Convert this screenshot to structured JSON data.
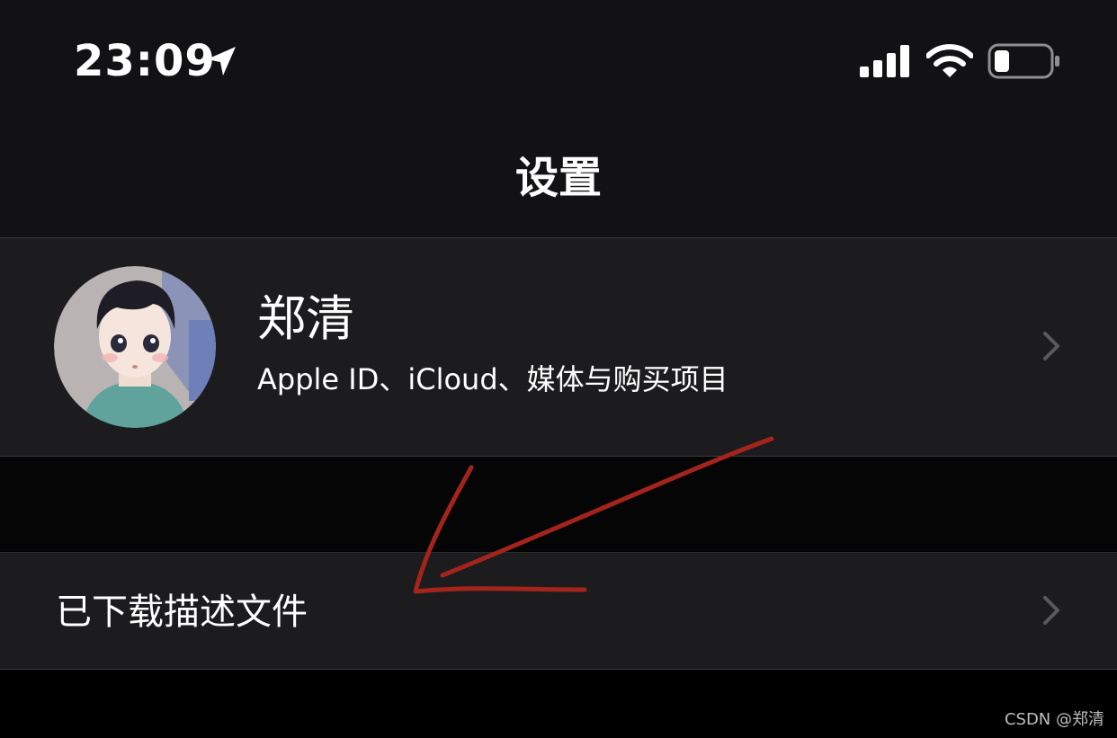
{
  "status_bar": {
    "time": "23:09",
    "icons": [
      "location-icon",
      "signal-icon",
      "wifi-icon",
      "battery-icon"
    ]
  },
  "nav": {
    "title": "设置"
  },
  "apple_id": {
    "name": "郑清",
    "subtitle": "Apple ID、iCloud、媒体与购买项目"
  },
  "profiles": {
    "label": "已下载描述文件"
  },
  "watermark": "CSDN @郑清",
  "colors": {
    "background": "#000000",
    "cell": "#1c1c1e",
    "separator": "#3a3a3c",
    "chevron": "#5a5a5e",
    "annotation": "#b3261e"
  }
}
